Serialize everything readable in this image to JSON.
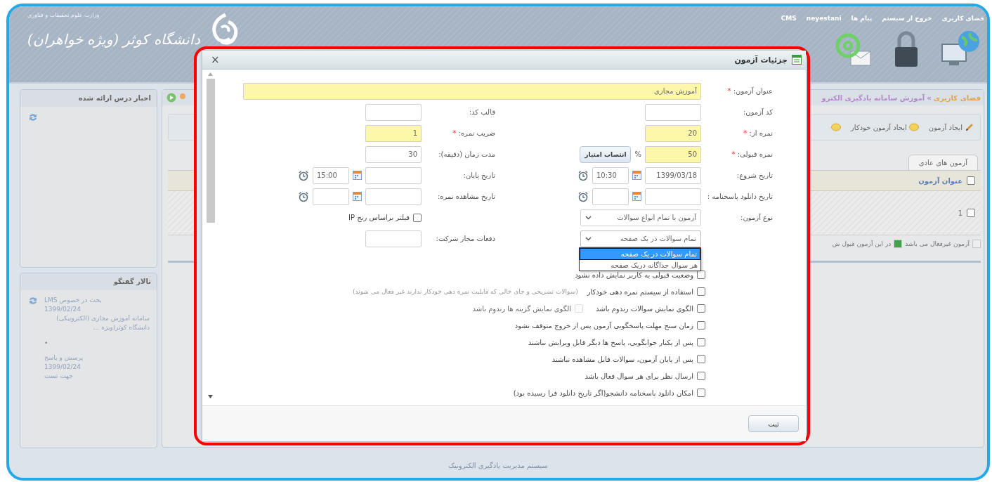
{
  "header": {
    "ministry": "وزارت علوم تحقیقات و فناوری",
    "university": "دانشگاه کوثر (ویژه خواهران)",
    "links": [
      {
        "label": "فضای کاربری"
      },
      {
        "label": "خروج از سیستم"
      },
      {
        "label": "پیام ها"
      },
      {
        "label": "neyestani"
      },
      {
        "label": "CMS"
      }
    ]
  },
  "sidebar": {
    "news": {
      "title": "اخبار درس ارائه شده"
    },
    "forum": {
      "title": "تالار گفتگو",
      "items": [
        {
          "kind": "post",
          "title": "بحث در خصوص LMS",
          "date": "1399/02/24",
          "body": "سامانه آموزش مجازی (الکترونیکی) دانشگاه کوثر(ویژه ..."
        },
        {
          "kind": "separator",
          "text": "•"
        },
        {
          "kind": "post",
          "title": "پرسش و پاسخ",
          "date": "1399/02/24",
          "body": "جهت تست"
        }
      ]
    }
  },
  "main": {
    "breadcrumb": {
      "home": "فضای کاربری",
      "separator": "»",
      "current": "آموزش سامانه یادگیری الکترو"
    },
    "toolbar": [
      {
        "kind": "create",
        "label": "ایجاد آزمون"
      },
      {
        "kind": "auto",
        "label": "ایجاد آزمون خودکار"
      },
      {
        "kind": "extra"
      }
    ],
    "tabs": [
      {
        "label": "آزمون های عادی",
        "selected": true
      }
    ],
    "table": {
      "header_checked": false,
      "columns": [
        "عنوان آزمون"
      ],
      "rows": [
        {
          "checked": false,
          "cells": [
            "1"
          ]
        }
      ]
    },
    "legend": [
      {
        "label": "آزمون غیرفعال می باشد",
        "color": "#eeeeee"
      },
      {
        "label": "در این آزمون قبول ش",
        "color": "#43a047"
      }
    ]
  },
  "dialog": {
    "title": "جزئیات آزمون",
    "close": "×",
    "title_field": {
      "label": "عنوان آزمون:",
      "mark": "*",
      "value": "آموزش مجازی"
    },
    "rows": [
      [
        {
          "kind": "text",
          "label": "کد آزمون:"
        },
        {
          "kind": "text",
          "label": "قالب کد:"
        }
      ],
      [
        {
          "kind": "text",
          "label": "نمره از:",
          "mark": "*",
          "value": "20"
        },
        {
          "kind": "text",
          "label": "ضریب نمره:",
          "mark": "*",
          "value": "1"
        }
      ],
      [
        {
          "kind": "score",
          "label": "نمره قبولی:",
          "mark": "*",
          "value": "50",
          "unit": "%",
          "button": "انتصاب امتیاز"
        },
        {
          "kind": "text",
          "label": "مدت زمان (دقیقه):",
          "value": "30"
        }
      ],
      [
        {
          "kind": "datetime",
          "label": "تاریخ شروع:",
          "date": "1399/03/18",
          "time": "10:30"
        },
        {
          "kind": "datetime",
          "label": "تاریخ پایان:",
          "time": "15:00"
        }
      ],
      [
        {
          "kind": "datetime",
          "label": "تاریخ دانلود پاسخنامه :"
        },
        {
          "kind": "datetime",
          "label": "تاریخ مشاهده نمره:"
        }
      ],
      [
        {
          "kind": "select",
          "label": "نوع آزمون:",
          "value": "آزمون با تمام انواع سوالات",
          "expanded": false
        },
        {
          "kind": "check",
          "label": "فیلتر براساس رنج IP",
          "checked": false
        }
      ],
      [
        {
          "kind": "select",
          "value": "تمام سوالات در یک صفحه",
          "expanded": true,
          "options": [
            {
              "label": "تمام سوالات در یک صفحه",
              "selected": true
            },
            {
              "label": "هر سوال جداگانه دریک صفحه",
              "selected": false
            }
          ]
        },
        {
          "kind": "text",
          "label": "دفعات مجاز شرکت:"
        }
      ]
    ],
    "checks": [
      {
        "label": "وضعیت قبولی به کاربر نمایش داده نشود",
        "checked": false
      },
      {
        "label": "استفاده از سیستم نمره دهی خودکار",
        "checked": false,
        "hint": "(سوالات تشریحی و جای خالی که قابلیت نمره دهی خودکار ندارند غیر فعال می شوند)"
      },
      {
        "label": "الگوی نمایش سوالات رندوم باشد",
        "checked": false,
        "sub": {
          "label": "الگوی نمایش گزینه ها رندوم باشد",
          "checked": false,
          "disabled": true
        }
      },
      {
        "label": "زمان سنج مهلت پاسخگویی آزمون پس از خروج متوقف نشود",
        "checked": false
      },
      {
        "label": "پس از یکبار جوابگویی، پاسخ ها دیگر قابل ویرایش نباشند",
        "checked": false
      },
      {
        "label": "پس از پایان آزمون، سوالات قابل مشاهده نباشند",
        "checked": false
      },
      {
        "label": "ارسال نظر برای هر سوال فعال باشد",
        "checked": false
      },
      {
        "label": "امکان دانلود پاسخنامه دانشجو(اگر تاریخ دانلود فرا رسیده بود)",
        "checked": false
      }
    ],
    "submit": "ثبت"
  },
  "footer": "سیستم مدیریت یادگیری الکترونیک"
}
